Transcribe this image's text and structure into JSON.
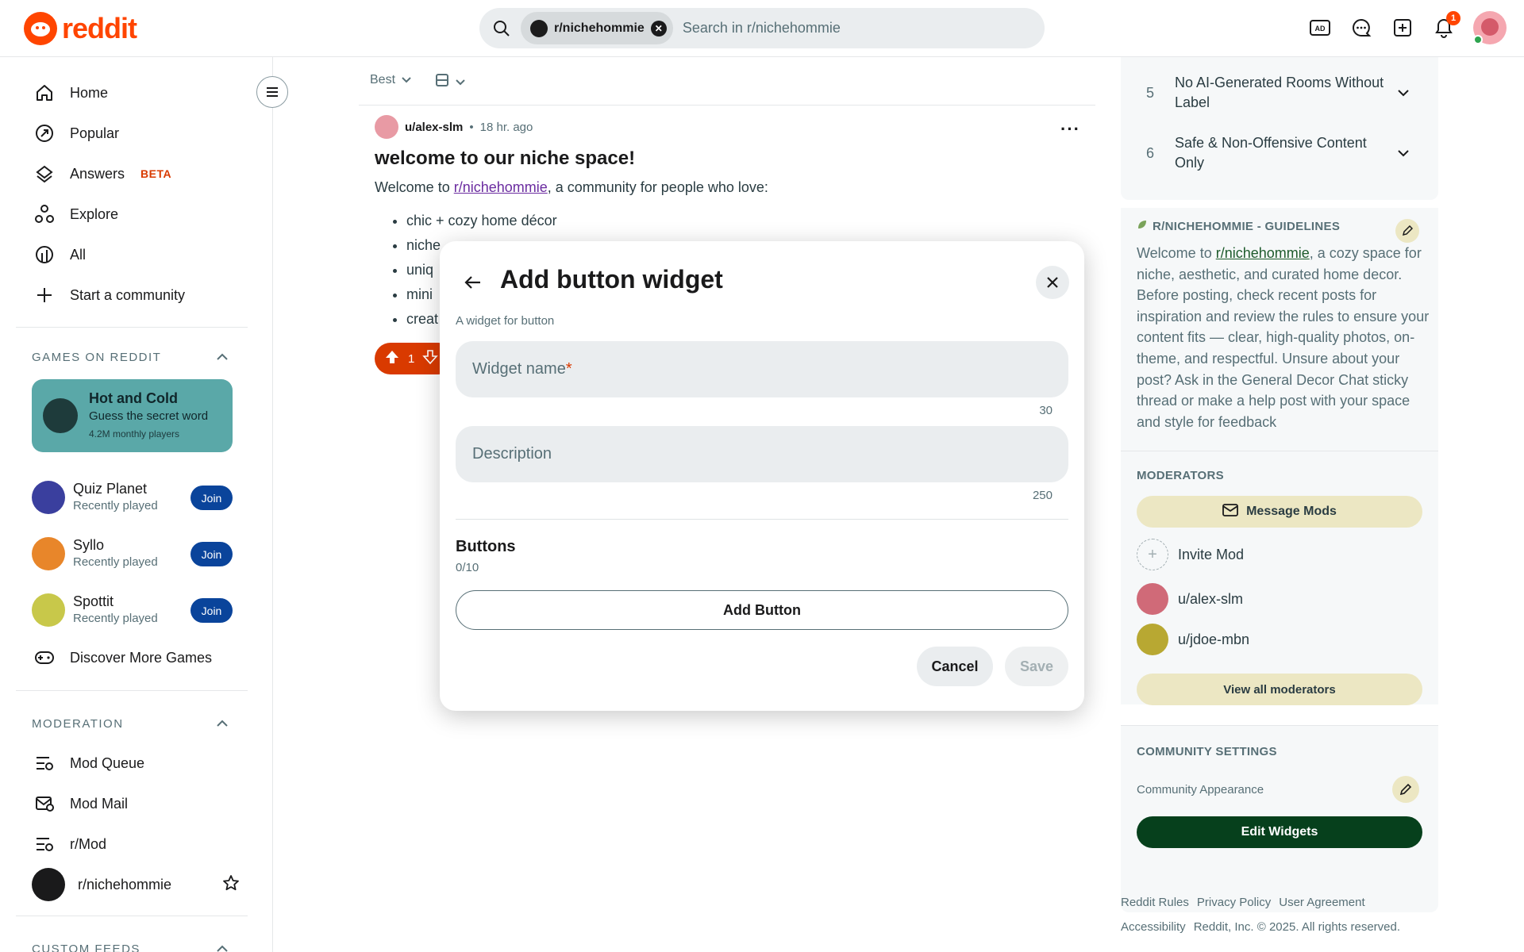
{
  "header": {
    "logo_text": "reddit",
    "search_chip": "r/nichehommie",
    "search_placeholder": "Search in r/nichehommie",
    "notification_count": "1"
  },
  "sidebar": {
    "nav": [
      {
        "label": "Home",
        "icon": "home-icon"
      },
      {
        "label": "Popular",
        "icon": "popular-icon"
      },
      {
        "label": "Answers",
        "icon": "answers-icon",
        "badge": "BETA"
      },
      {
        "label": "Explore",
        "icon": "explore-icon"
      },
      {
        "label": "All",
        "icon": "all-icon"
      },
      {
        "label": "Start a community",
        "icon": "plus-icon"
      }
    ],
    "games_title": "GAMES ON REDDIT",
    "featured_game": {
      "title": "Hot and Cold",
      "subtitle": "Guess the secret word",
      "players": "4.2M monthly players"
    },
    "games": [
      {
        "name": "Quiz Planet",
        "sub": "Recently played",
        "join": "Join"
      },
      {
        "name": "Syllo",
        "sub": "Recently played",
        "join": "Join"
      },
      {
        "name": "Spottit",
        "sub": "Recently played",
        "join": "Join"
      }
    ],
    "discover_games": "Discover More Games",
    "moderation_title": "MODERATION",
    "moderation": [
      {
        "label": "Mod Queue"
      },
      {
        "label": "Mod Mail"
      },
      {
        "label": "r/Mod"
      },
      {
        "label": "r/nichehommie"
      }
    ],
    "custom_feeds_title": "CUSTOM FEEDS"
  },
  "feed": {
    "sort_label": "Best",
    "post": {
      "author": "u/alex-slm",
      "time": "18 hr. ago",
      "title": "welcome to our niche space!",
      "intro_before": "Welcome to ",
      "intro_link": "r/nichehommie",
      "intro_after": ", a community for people who love:",
      "list": [
        "chic + cozy home décor",
        "niche",
        "uniq",
        "mini",
        "creat"
      ],
      "votes": "1"
    }
  },
  "right": {
    "rules": [
      {
        "num": "5",
        "text": "No AI-Generated Rooms Without Label"
      },
      {
        "num": "6",
        "text": "Safe & Non-Offensive Content Only"
      }
    ],
    "guidelines_title": "R/NICHEHOMMIE - GUIDELINES",
    "guidelines_before": "Welcome to ",
    "guidelines_link": "r/nichehommie",
    "guidelines_after": ", a cozy space for niche, aesthetic, and curated home decor. Before posting, check recent posts for inspiration and review the rules to ensure your content fits — clear, high-quality photos, on-theme, and respectful. Unsure about your post? Ask in the General Decor Chat sticky thread or make a help post with your space and style for feedback",
    "moderators_title": "MODERATORS",
    "message_mods": "Message Mods",
    "invite_mod": "Invite Mod",
    "mods": [
      "u/alex-slm",
      "u/jdoe-mbn"
    ],
    "view_all_mods": "View all moderators",
    "community_settings_title": "COMMUNITY SETTINGS",
    "community_appearance": "Community Appearance",
    "edit_widgets": "Edit Widgets",
    "footer": {
      "row1": [
        "Reddit Rules",
        "Privacy Policy",
        "User Agreement"
      ],
      "row2": [
        "Accessibility",
        "Reddit, Inc. © 2025. All rights reserved."
      ]
    }
  },
  "modal": {
    "title": "Add button widget",
    "subtitle": "A widget for button",
    "widget_name_placeholder": "Widget name",
    "widget_name_required": "*",
    "widget_name_counter": "30",
    "description_placeholder": "Description",
    "description_counter": "250",
    "buttons_title": "Buttons",
    "buttons_count": "0/10",
    "add_button": "Add Button",
    "cancel": "Cancel",
    "save": "Save"
  }
}
